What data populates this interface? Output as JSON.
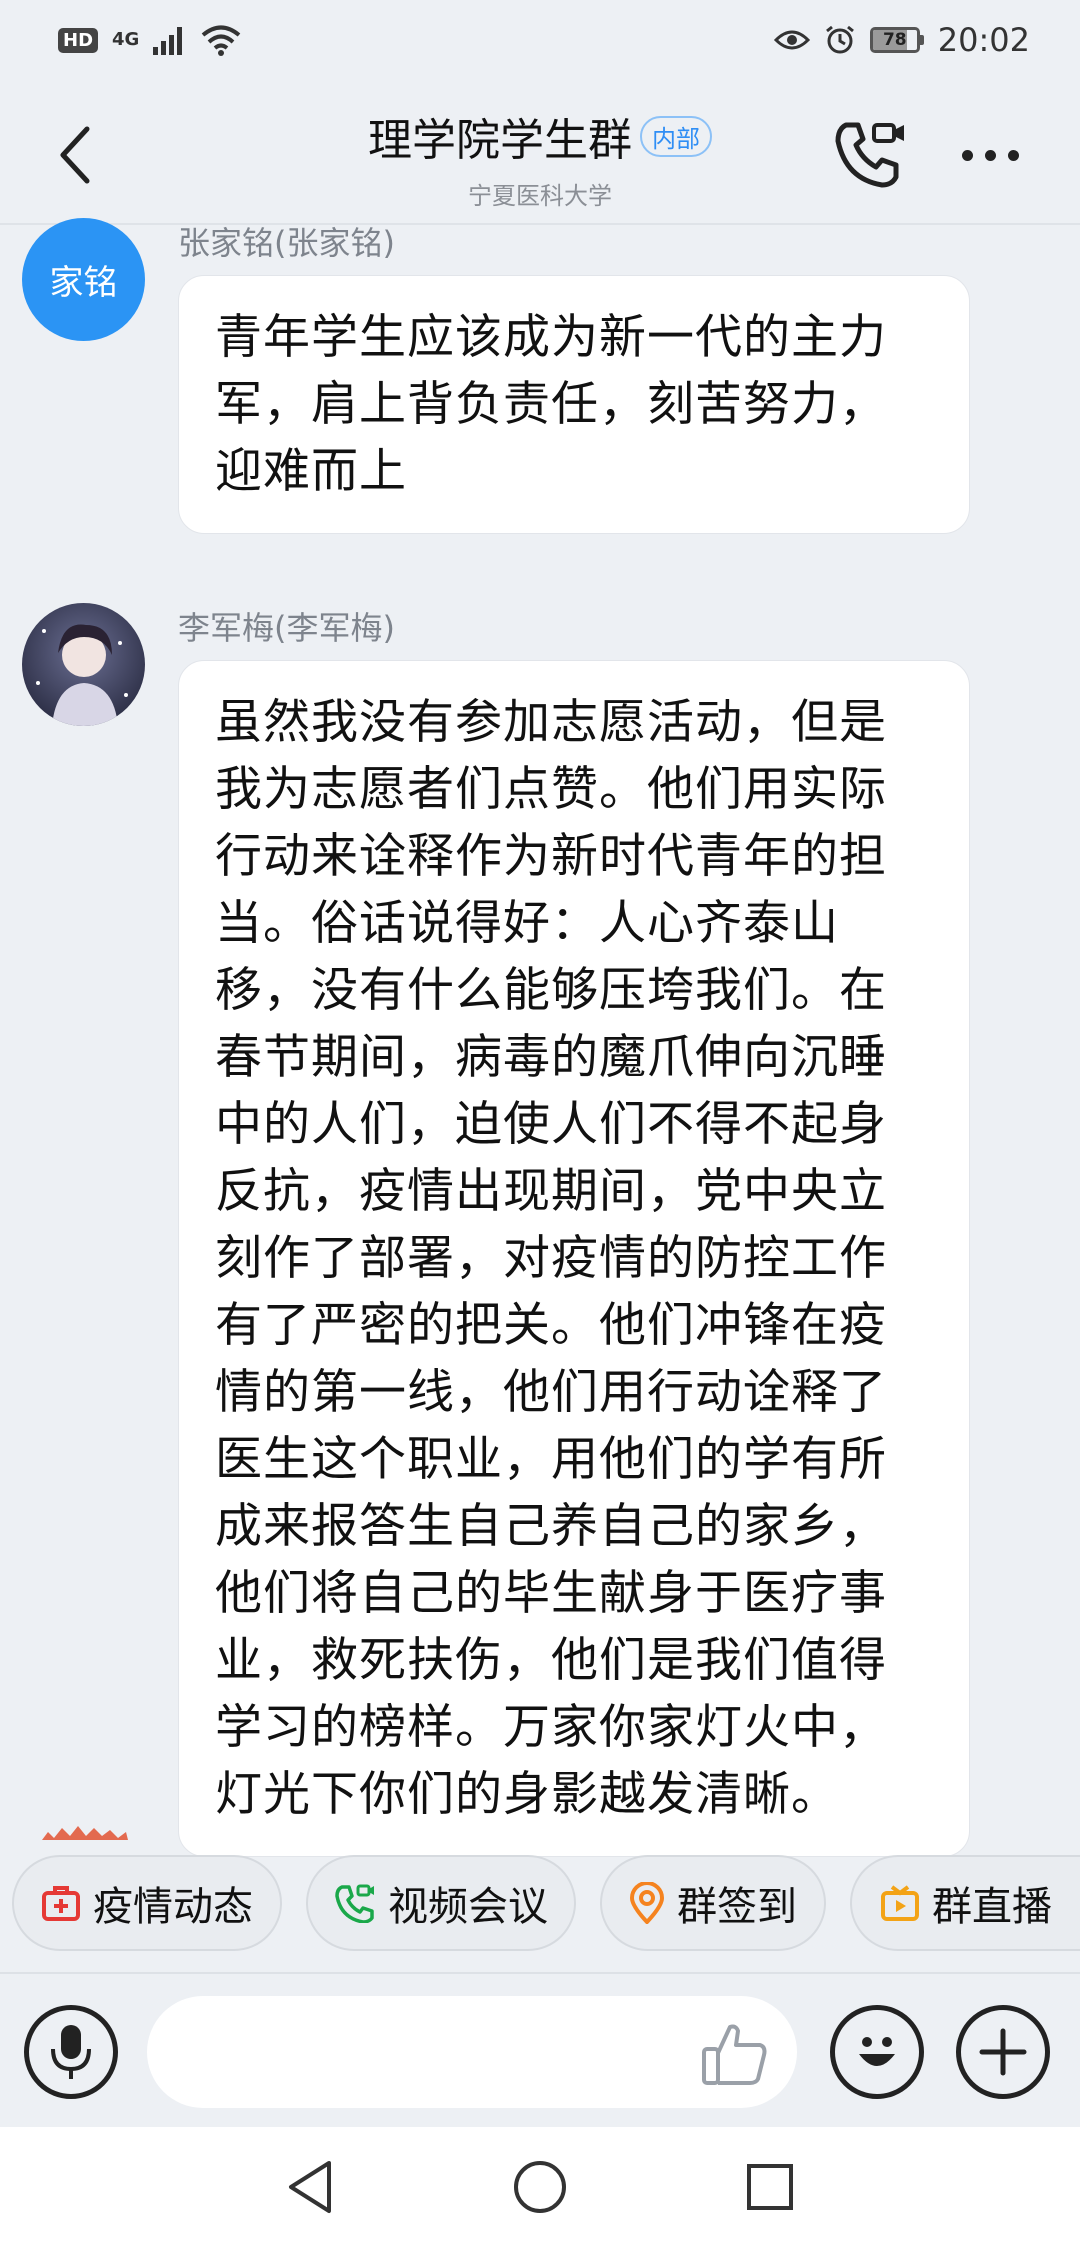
{
  "status_bar": {
    "hd": "HD",
    "network": "4G",
    "battery": "78",
    "battery_level": 0.78,
    "time": "20:02"
  },
  "header": {
    "title": "理学院学生群",
    "tag": "内部",
    "subtitle": "宁夏医科大学"
  },
  "messages": [
    {
      "avatar_text": "家铭",
      "sender": "张家铭(张家铭)",
      "text": "青年学生应该成为新一代的主力军，肩上背负责任，刻苦努力，迎难而上"
    },
    {
      "avatar_text": "",
      "sender": "李军梅(李军梅)",
      "text": "虽然我没有参加志愿活动，但是我为志愿者们点赞。他们用实际行动来诠释作为新时代青年的担当。俗话说得好：人心齐泰山移，没有什么能够压垮我们。在春节期间，病毒的魔爪伸向沉睡中的人们，迫使人们不得不起身反抗，疫情出现期间，党中央立刻作了部署，对疫情的防控工作有了严密的把关。他们冲锋在疫情的第一线，他们用行动诠释了医生这个职业，用他们的学有所成来报答生自己养自己的家乡，他们将自己的毕生献身于医疗事业，救死扶伤，他们是我们值得学习的榜样。万家你家灯火中，灯光下你们的身影越发清晰。"
    }
  ],
  "quick_actions": [
    {
      "label": "疫情动态",
      "icon": "medkit-icon",
      "color": "#e53935"
    },
    {
      "label": "视频会议",
      "icon": "video-call-icon",
      "color": "#1aa84a"
    },
    {
      "label": "群签到",
      "icon": "location-pin-icon",
      "color": "#f5831f"
    },
    {
      "label": "群直播",
      "icon": "tv-icon",
      "color": "#f3a316"
    }
  ],
  "input": {
    "placeholder": ""
  },
  "colors": {
    "background": "#edf0f4",
    "accent": "#2b94f4",
    "bubble": "#ffffff"
  }
}
